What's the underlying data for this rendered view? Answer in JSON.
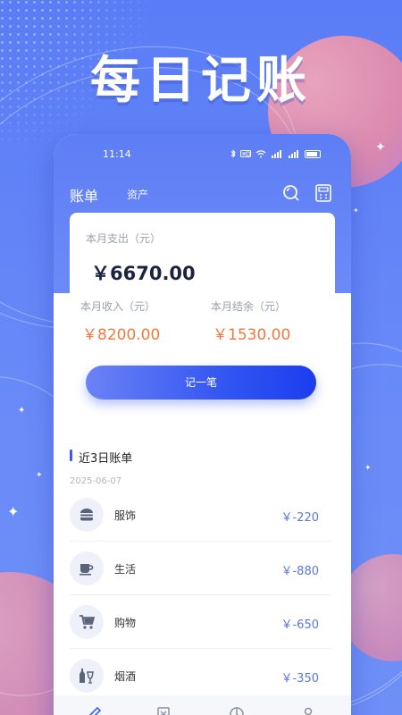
{
  "headline": "每日记账",
  "status_bar": {
    "time": "11:14",
    "icons": [
      "bluetooth-icon",
      "hd-icon",
      "wifi-icon",
      "signal-icon",
      "signal-icon",
      "battery-icon"
    ]
  },
  "nav": {
    "tab_bills": "账单",
    "tab_assets": "资产",
    "icons": [
      "search-icon",
      "calculator-icon"
    ]
  },
  "summary": {
    "expense_label": "本月支出（元）",
    "expense_value": "￥6670.00",
    "income_label": "本月收入（元）",
    "income_value": "￥8200.00",
    "balance_label": "本月结余（元）",
    "balance_value": "￥1530.00"
  },
  "record_button": "记一笔",
  "recent": {
    "title": "近3日账单",
    "date": "2025-06-07",
    "items": [
      {
        "name": "服饰",
        "amount": "￥-220",
        "icon": "burger-icon"
      },
      {
        "name": "生活",
        "amount": "￥-880",
        "icon": "cup-icon"
      },
      {
        "name": "购物",
        "amount": "￥-650",
        "icon": "cart-icon"
      },
      {
        "name": "烟酒",
        "amount": "￥-350",
        "icon": "bottle-icon"
      }
    ]
  },
  "tabbar": {
    "icons": [
      "pen-icon",
      "ledger-icon",
      "chart-icon",
      "user-icon"
    ]
  },
  "colors": {
    "accent": "#3a5cf2",
    "income": "#f07a3c",
    "amount": "#5b78d8",
    "background": "#5d7ff7"
  }
}
